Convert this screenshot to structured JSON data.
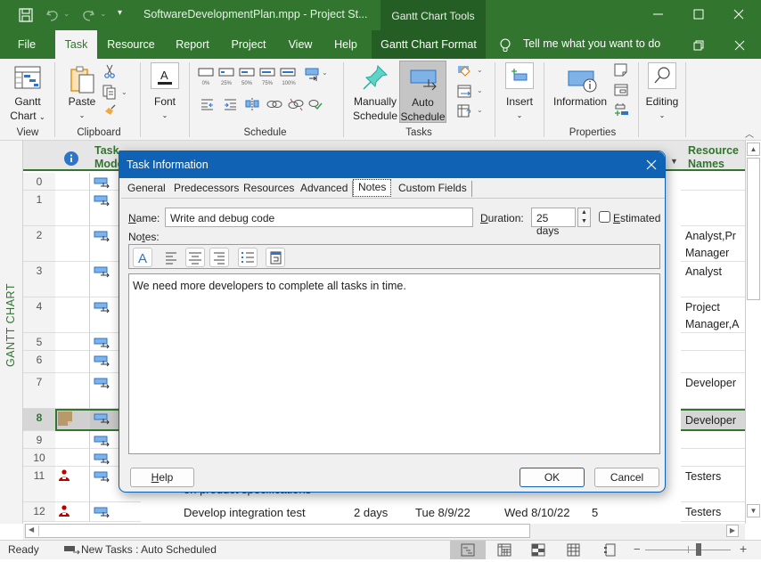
{
  "window": {
    "title": "SoftwareDevelopmentPlan.mpp  -  Project St...",
    "context_tab_group": "Gantt Chart Tools",
    "controls": {
      "minimize": "minimize-icon",
      "maximize": "maximize-icon",
      "close": "close-icon"
    }
  },
  "quick_access": [
    {
      "name": "save",
      "icon": "save-icon"
    },
    {
      "name": "undo",
      "icon": "undo-icon"
    },
    {
      "name": "redo",
      "icon": "redo-icon"
    },
    {
      "name": "customize",
      "icon": "customize-qat-icon"
    }
  ],
  "ribbon_tabs": [
    "File",
    "Task",
    "Resource",
    "Report",
    "Project",
    "View",
    "Help",
    "Gantt Chart Format"
  ],
  "active_tab": "Task",
  "tell_me": "Tell me what you want to do",
  "ribbon": {
    "view": {
      "label": "View",
      "gantt_chart": "Gantt",
      "gantt_chart_2": "Chart"
    },
    "clipboard": {
      "label": "Clipboard",
      "paste": "Paste"
    },
    "font": {
      "label": "Font"
    },
    "schedule": {
      "label": "Schedule",
      "percents": [
        "0%",
        "25%",
        "50%",
        "75%",
        "100%"
      ]
    },
    "tasks": {
      "label": "Tasks",
      "manually_1": "Manually",
      "manually_2": "Schedule",
      "auto_1": "Auto",
      "auto_2": "Schedule"
    },
    "insert": {
      "label": "Insert"
    },
    "properties": {
      "label": "Properties",
      "information": "Information"
    },
    "editing": {
      "label": "Editing"
    }
  },
  "sheet": {
    "view_label": "GANTT CHART",
    "headers": {
      "indicators": "info-icon",
      "task_mode_1": "Task",
      "task_mode_2": "Mode",
      "resource_1": "Resource",
      "resource_2": "Names"
    },
    "rows": [
      {
        "id": "0",
        "indicator": "",
        "resources": ""
      },
      {
        "id": "1",
        "indicator": "",
        "resources": ""
      },
      {
        "id": "2",
        "indicator": "",
        "resources": "Analyst,Pr",
        "resources_2": "Manager"
      },
      {
        "id": "3",
        "indicator": "",
        "resources": "Analyst"
      },
      {
        "id": "4",
        "indicator": "",
        "resources": "Project",
        "resources_2": "Manager,A"
      },
      {
        "id": "5",
        "indicator": "",
        "resources": ""
      },
      {
        "id": "6",
        "indicator": "",
        "resources": ""
      },
      {
        "id": "7",
        "indicator": "",
        "resources": "Developer"
      },
      {
        "id": "8",
        "indicator": "note",
        "resources": "Developer",
        "selected": true
      },
      {
        "id": "9",
        "indicator": "",
        "resources": ""
      },
      {
        "id": "10",
        "indicator": "",
        "resources": ""
      },
      {
        "id": "11",
        "indicator": "resource",
        "resources": "Testers",
        "name_partial": "on product specifications"
      },
      {
        "id": "12",
        "indicator": "resource",
        "resources": "Testers",
        "name": "Develop integration test",
        "duration": "2 days",
        "start": "Tue 8/9/22",
        "finish": "Wed 8/10/22",
        "predecessors": "5"
      }
    ]
  },
  "dialog": {
    "title": "Task Information",
    "tabs": [
      "General",
      "Predecessors",
      "Resources",
      "Advanced",
      "Notes",
      "Custom Fields"
    ],
    "active_tab": "Notes",
    "name_label": "Name:",
    "name_value": "Write and debug code",
    "duration_label": "Duration:",
    "duration_value": "25 days",
    "estimated_label": "Estimated",
    "estimated_checked": false,
    "notes_label": "Notes:",
    "notes_text": "We need more developers to complete all tasks in time.",
    "buttons": {
      "help": "Help",
      "ok": "OK",
      "cancel": "Cancel"
    }
  },
  "status_bar": {
    "ready": "Ready",
    "new_tasks": "New Tasks : Auto Scheduled",
    "zoom_level": 0.63
  }
}
